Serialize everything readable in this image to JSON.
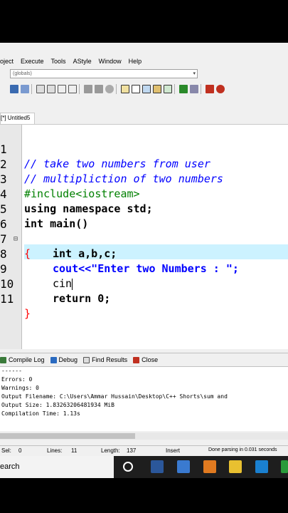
{
  "menu": [
    "oject",
    "Execute",
    "Tools",
    "AStyle",
    "Window",
    "Help"
  ],
  "globals_combo": "(globals)",
  "file_tab": "[*] Untitled5",
  "editor": {
    "lines": [
      {
        "n": "1",
        "text": "// take two numbers from user"
      },
      {
        "n": "2",
        "text": "// multipliction of two numbers"
      },
      {
        "n": "3",
        "text": "#include<iostream>"
      },
      {
        "n": "4",
        "text": "using namespace std;"
      },
      {
        "n": "5",
        "text": "int main()"
      },
      {
        "n": "6",
        "text": "{"
      },
      {
        "n": "7",
        "text": "int a,b,c;"
      },
      {
        "n": "8",
        "text": "cout<<\"Enter two Numbers : \";"
      },
      {
        "n": "9",
        "text": "cin"
      },
      {
        "n": "10",
        "text": "return 0;"
      },
      {
        "n": "11",
        "text": "}"
      }
    ],
    "fold_marker": "⊟"
  },
  "bottom_tabs": [
    "Compile Log",
    "Debug",
    "Find Results",
    "Close"
  ],
  "compile_log": [
    "------",
    "Errors: 0",
    "Warnings: 0",
    "Output Filename: C:\\Users\\Ammar Hussain\\Desktop\\C++ Shorts\\sum and",
    "Output Size: 1.83263206481934 MiB",
    "Compilation Time: 1.13s"
  ],
  "status": {
    "sel_label": "Sel:",
    "sel_value": "0",
    "lines_label": "Lines:",
    "lines_value": "11",
    "length_label": "Length:",
    "length_value": "137",
    "mode": "Insert",
    "message": "Done parsing in 0.031 seconds"
  },
  "taskbar": {
    "search": "earch"
  },
  "colors": {
    "comment": "#0000ff",
    "preprocessor": "#008000",
    "string": "#0000ff",
    "number": "#a00000",
    "highlight_line": "#ccf2ff",
    "taskbar": "#1e1e1e"
  }
}
